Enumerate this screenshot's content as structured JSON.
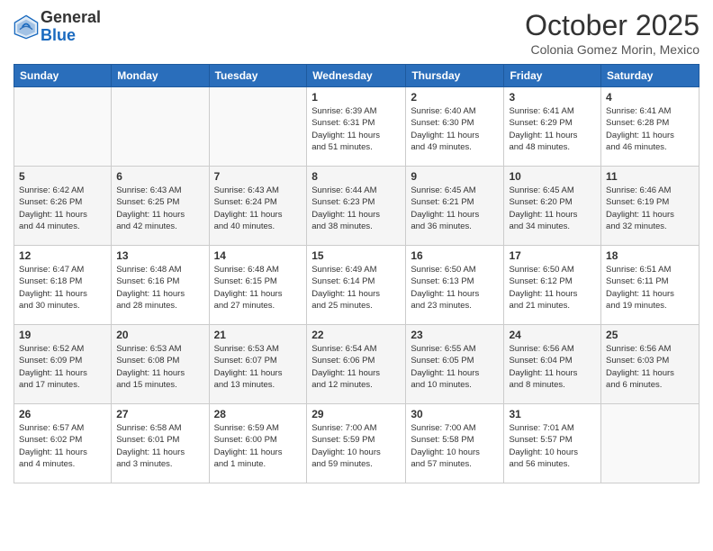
{
  "header": {
    "logo_general": "General",
    "logo_blue": "Blue",
    "month": "October 2025",
    "location": "Colonia Gomez Morin, Mexico"
  },
  "days_of_week": [
    "Sunday",
    "Monday",
    "Tuesday",
    "Wednesday",
    "Thursday",
    "Friday",
    "Saturday"
  ],
  "weeks": [
    [
      {
        "day": "",
        "info": ""
      },
      {
        "day": "",
        "info": ""
      },
      {
        "day": "",
        "info": ""
      },
      {
        "day": "1",
        "info": "Sunrise: 6:39 AM\nSunset: 6:31 PM\nDaylight: 11 hours\nand 51 minutes."
      },
      {
        "day": "2",
        "info": "Sunrise: 6:40 AM\nSunset: 6:30 PM\nDaylight: 11 hours\nand 49 minutes."
      },
      {
        "day": "3",
        "info": "Sunrise: 6:41 AM\nSunset: 6:29 PM\nDaylight: 11 hours\nand 48 minutes."
      },
      {
        "day": "4",
        "info": "Sunrise: 6:41 AM\nSunset: 6:28 PM\nDaylight: 11 hours\nand 46 minutes."
      }
    ],
    [
      {
        "day": "5",
        "info": "Sunrise: 6:42 AM\nSunset: 6:26 PM\nDaylight: 11 hours\nand 44 minutes."
      },
      {
        "day": "6",
        "info": "Sunrise: 6:43 AM\nSunset: 6:25 PM\nDaylight: 11 hours\nand 42 minutes."
      },
      {
        "day": "7",
        "info": "Sunrise: 6:43 AM\nSunset: 6:24 PM\nDaylight: 11 hours\nand 40 minutes."
      },
      {
        "day": "8",
        "info": "Sunrise: 6:44 AM\nSunset: 6:23 PM\nDaylight: 11 hours\nand 38 minutes."
      },
      {
        "day": "9",
        "info": "Sunrise: 6:45 AM\nSunset: 6:21 PM\nDaylight: 11 hours\nand 36 minutes."
      },
      {
        "day": "10",
        "info": "Sunrise: 6:45 AM\nSunset: 6:20 PM\nDaylight: 11 hours\nand 34 minutes."
      },
      {
        "day": "11",
        "info": "Sunrise: 6:46 AM\nSunset: 6:19 PM\nDaylight: 11 hours\nand 32 minutes."
      }
    ],
    [
      {
        "day": "12",
        "info": "Sunrise: 6:47 AM\nSunset: 6:18 PM\nDaylight: 11 hours\nand 30 minutes."
      },
      {
        "day": "13",
        "info": "Sunrise: 6:48 AM\nSunset: 6:16 PM\nDaylight: 11 hours\nand 28 minutes."
      },
      {
        "day": "14",
        "info": "Sunrise: 6:48 AM\nSunset: 6:15 PM\nDaylight: 11 hours\nand 27 minutes."
      },
      {
        "day": "15",
        "info": "Sunrise: 6:49 AM\nSunset: 6:14 PM\nDaylight: 11 hours\nand 25 minutes."
      },
      {
        "day": "16",
        "info": "Sunrise: 6:50 AM\nSunset: 6:13 PM\nDaylight: 11 hours\nand 23 minutes."
      },
      {
        "day": "17",
        "info": "Sunrise: 6:50 AM\nSunset: 6:12 PM\nDaylight: 11 hours\nand 21 minutes."
      },
      {
        "day": "18",
        "info": "Sunrise: 6:51 AM\nSunset: 6:11 PM\nDaylight: 11 hours\nand 19 minutes."
      }
    ],
    [
      {
        "day": "19",
        "info": "Sunrise: 6:52 AM\nSunset: 6:09 PM\nDaylight: 11 hours\nand 17 minutes."
      },
      {
        "day": "20",
        "info": "Sunrise: 6:53 AM\nSunset: 6:08 PM\nDaylight: 11 hours\nand 15 minutes."
      },
      {
        "day": "21",
        "info": "Sunrise: 6:53 AM\nSunset: 6:07 PM\nDaylight: 11 hours\nand 13 minutes."
      },
      {
        "day": "22",
        "info": "Sunrise: 6:54 AM\nSunset: 6:06 PM\nDaylight: 11 hours\nand 12 minutes."
      },
      {
        "day": "23",
        "info": "Sunrise: 6:55 AM\nSunset: 6:05 PM\nDaylight: 11 hours\nand 10 minutes."
      },
      {
        "day": "24",
        "info": "Sunrise: 6:56 AM\nSunset: 6:04 PM\nDaylight: 11 hours\nand 8 minutes."
      },
      {
        "day": "25",
        "info": "Sunrise: 6:56 AM\nSunset: 6:03 PM\nDaylight: 11 hours\nand 6 minutes."
      }
    ],
    [
      {
        "day": "26",
        "info": "Sunrise: 6:57 AM\nSunset: 6:02 PM\nDaylight: 11 hours\nand 4 minutes."
      },
      {
        "day": "27",
        "info": "Sunrise: 6:58 AM\nSunset: 6:01 PM\nDaylight: 11 hours\nand 3 minutes."
      },
      {
        "day": "28",
        "info": "Sunrise: 6:59 AM\nSunset: 6:00 PM\nDaylight: 11 hours\nand 1 minute."
      },
      {
        "day": "29",
        "info": "Sunrise: 7:00 AM\nSunset: 5:59 PM\nDaylight: 10 hours\nand 59 minutes."
      },
      {
        "day": "30",
        "info": "Sunrise: 7:00 AM\nSunset: 5:58 PM\nDaylight: 10 hours\nand 57 minutes."
      },
      {
        "day": "31",
        "info": "Sunrise: 7:01 AM\nSunset: 5:57 PM\nDaylight: 10 hours\nand 56 minutes."
      },
      {
        "day": "",
        "info": ""
      }
    ]
  ]
}
